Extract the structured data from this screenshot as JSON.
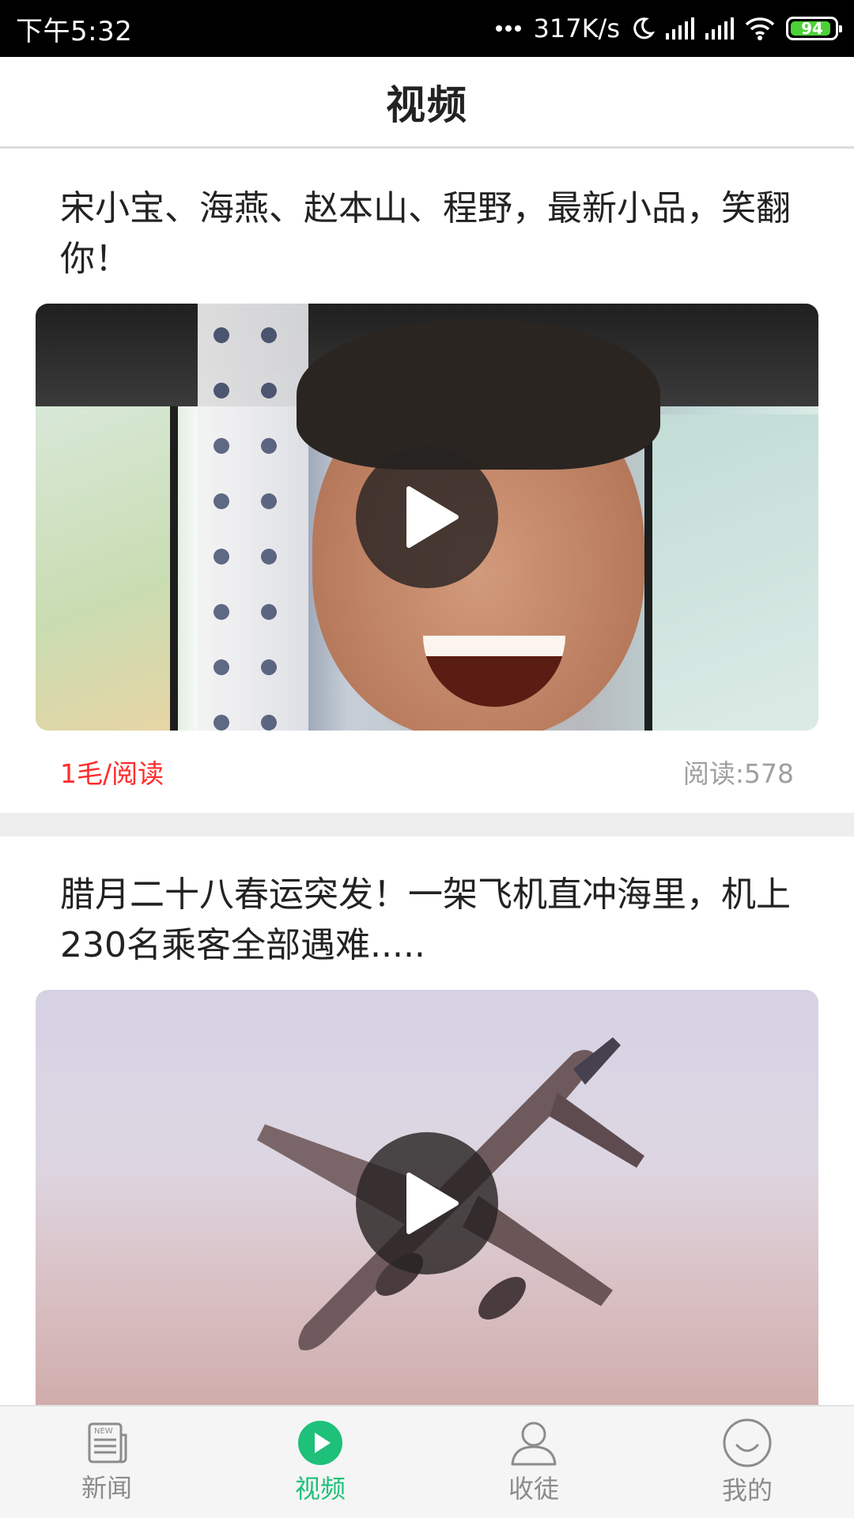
{
  "status_bar": {
    "time": "下午5:32",
    "network_speed": "317K/s",
    "battery_level": "94",
    "icons": [
      "more-dots-icon",
      "moon-icon",
      "signal-icon",
      "signal-icon",
      "wifi-icon",
      "battery-icon"
    ]
  },
  "header": {
    "title": "视频"
  },
  "feed": {
    "items": [
      {
        "title": "宋小宝、海燕、赵本山、程野，最新小品，笑翻你！",
        "reward": "1毛/阅读",
        "read_count": "阅读:578",
        "thumbnail": "video-thumbnail-laughing-man"
      },
      {
        "title": "腊月二十八春运突发！一架飞机直冲海里，机上230名乘客全部遇难.....",
        "thumbnail": "video-thumbnail-airplane"
      }
    ]
  },
  "bottom_nav": {
    "items": [
      {
        "label": "新闻",
        "icon": "newspaper-icon",
        "active": false
      },
      {
        "label": "视频",
        "icon": "play-circle-icon",
        "active": true
      },
      {
        "label": "收徒",
        "icon": "user-icon",
        "active": false
      },
      {
        "label": "我的",
        "icon": "smiley-icon",
        "active": false
      }
    ]
  },
  "colors": {
    "accent": "#1fc079",
    "reward": "#ff2b2b",
    "muted": "#a0a0a0",
    "battery": "#4cd137"
  }
}
